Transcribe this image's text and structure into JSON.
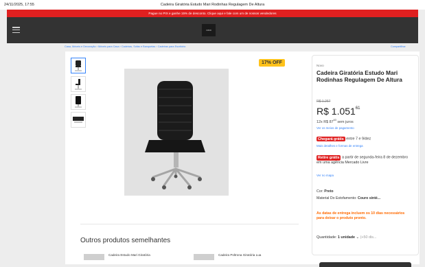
{
  "print_header": {
    "datetime": "24/11/2025, 17:55",
    "page_title": "Cadeira Giratória Estudo Mari Rodinhas Regulagem De Altura"
  },
  "promo_bar": {
    "text": "Pague no PIX e ganhe 15% de desconto. Clique aqui e fale com um de nossos vendedores",
    "color": "#e02020"
  },
  "header": {
    "menu_icon": "hamburger-menu-icon",
    "logo_text": "casa",
    "background": "#333333"
  },
  "breadcrumb": {
    "text": "Casa, Móveis e Decoração  ›  Móveis para Casa  ›  Cadeiras, Sofás e Banquetas  ›  Cadeiras para Escritório",
    "share": "Compartilhar"
  },
  "gallery": {
    "thumbnails": [
      "chair-front",
      "chair-side",
      "chair-back",
      "chair-base"
    ],
    "selected_index": 0,
    "discount_badge": "17% OFF"
  },
  "product": {
    "condition": "Novo",
    "title": "Cadeira Giratória Estudo Mari Rodinhas Regulagem De Altura",
    "old_price": "R$ 1.267",
    "price_main": "R$ 1.051",
    "price_cents": "61",
    "installments_prefix": "12x R$ 87",
    "installments_cents": "63",
    "installments_suffix": "sem juros",
    "payment_link": "Ver os meios de pagamento",
    "shipping_tag": "Chegará grátis",
    "shipping_text": "entre 7 e 9/dez",
    "shipping_link": "Mais detalhes e formas de entrega",
    "pickup_tag": "Retire grátis",
    "pickup_text": "a partir de segunda-feira 8 de dezembro em uma agência Mercado Livre",
    "pickup_link": "Ver no mapa",
    "color_label": "Cor:",
    "color_value": "Preto",
    "material_label": "Material Do Estofamento:",
    "material_value": "Couro sinté...",
    "notice": "As datas de entrega incluem os 10 dias necessários para deixar o produto pronto.",
    "quantity_label": "Quantidade:",
    "quantity_value": "1 unidade",
    "quantity_available": "(+50 dis..."
  },
  "similar": {
    "title": "Outros produtos semelhantes",
    "items": [
      {
        "name": "Cadeira Estudo Mari Giratória"
      },
      {
        "name": "Cadeira Poltrona Giratória Lua"
      }
    ]
  }
}
